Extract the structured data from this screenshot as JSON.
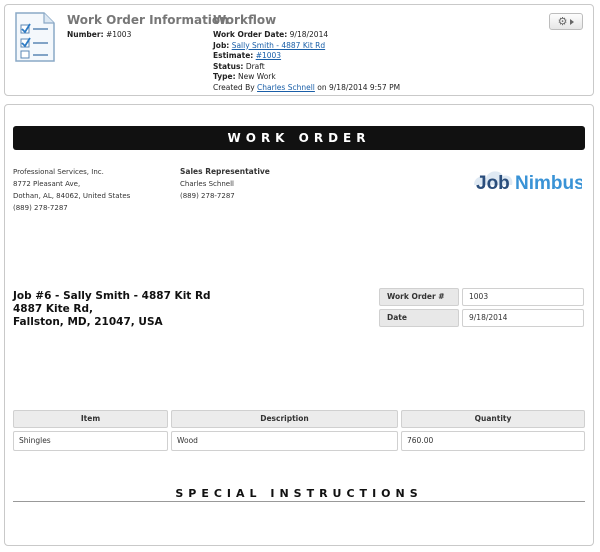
{
  "work_order_info": {
    "title": "Work Order Information",
    "number_label": "Number:",
    "number": "#1003"
  },
  "workflow": {
    "title": "Workflow",
    "date_label": "Work Order Date:",
    "date": "9/18/2014",
    "job_label": "Job:",
    "job_link": "Sally Smith - 4887 Kit Rd",
    "estimate_label": "Estimate:",
    "estimate_link": "#1003",
    "status_label": "Status:",
    "status": "Draft",
    "type_label": "Type:",
    "type": "New Work",
    "created_prefix": "Created By",
    "created_by": "Charles Schnell",
    "created_suffix": "on 9/18/2014 9:57 PM"
  },
  "document": {
    "banner": "WORK ORDER",
    "company": {
      "name": "Professional Services, Inc.",
      "address1": "8772 Pleasant Ave,",
      "address2": "Dothan, AL, 84062, United States",
      "phone": "(889) 278-7287"
    },
    "sales_rep": {
      "heading": "Sales Representative",
      "name": "Charles Schnell",
      "phone": "(889) 278-7287"
    },
    "logo": {
      "part1": "Job",
      "part2": "Nimbus"
    },
    "job": {
      "line1": "Job #6 - Sally Smith - 4887 Kit Rd",
      "line2": "4887 Kite Rd,",
      "line3": "Fallston, MD, 21047, USA"
    },
    "meta": {
      "wo_label": "Work Order #",
      "wo_value": "1003",
      "date_label": "Date",
      "date_value": "9/18/2014"
    },
    "items_table": {
      "headers": [
        "Item",
        "Description",
        "Quantity"
      ],
      "rows": [
        [
          "Shingles",
          "Wood",
          "760.00"
        ]
      ]
    },
    "special_instructions": "SPECIAL INSTRUCTIONS"
  },
  "colors": {
    "link": "#1a5fa8",
    "banner_bg": "#111111",
    "logo_dark": "#2b4e7c",
    "logo_light": "#3a93d6"
  }
}
